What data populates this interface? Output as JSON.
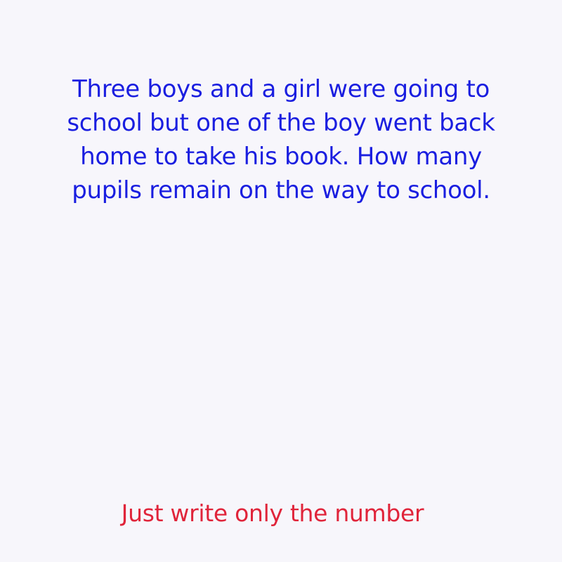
{
  "question": {
    "lines": [
      "Three boys and a girl were going to",
      "school but one of the boy went back",
      "home to take his book. How many",
      "pupils remain on the way to school."
    ]
  },
  "instruction": "Just write only the number",
  "colors": {
    "background": "#f7f6fb",
    "question_text": "#1a1ee0",
    "instruction_text": "#e0243a"
  }
}
